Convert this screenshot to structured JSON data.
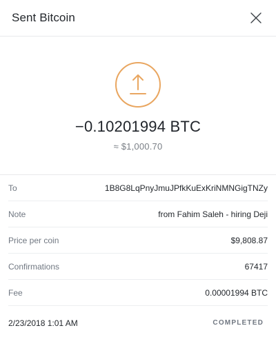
{
  "header": {
    "title": "Sent Bitcoin"
  },
  "transaction": {
    "amount": "−0.10201994 BTC",
    "fiat_value": "≈ $1,000.70"
  },
  "details": [
    {
      "label": "To",
      "value": "1B8G8LqPnyJmuJPfkKuExKriNMNGigTNZy"
    },
    {
      "label": "Note",
      "value": "from Fahim Saleh - hiring Deji"
    },
    {
      "label": "Price per coin",
      "value": "$9,808.87"
    },
    {
      "label": "Confirmations",
      "value": "67417"
    },
    {
      "label": "Fee",
      "value": "0.00001994 BTC"
    }
  ],
  "footer": {
    "date": "2/23/2018 1:01 AM",
    "status": "COMPLETED"
  },
  "colors": {
    "accent": "#e9a660"
  },
  "icons": {
    "send": "upload-arrow-icon",
    "close": "close-icon"
  }
}
